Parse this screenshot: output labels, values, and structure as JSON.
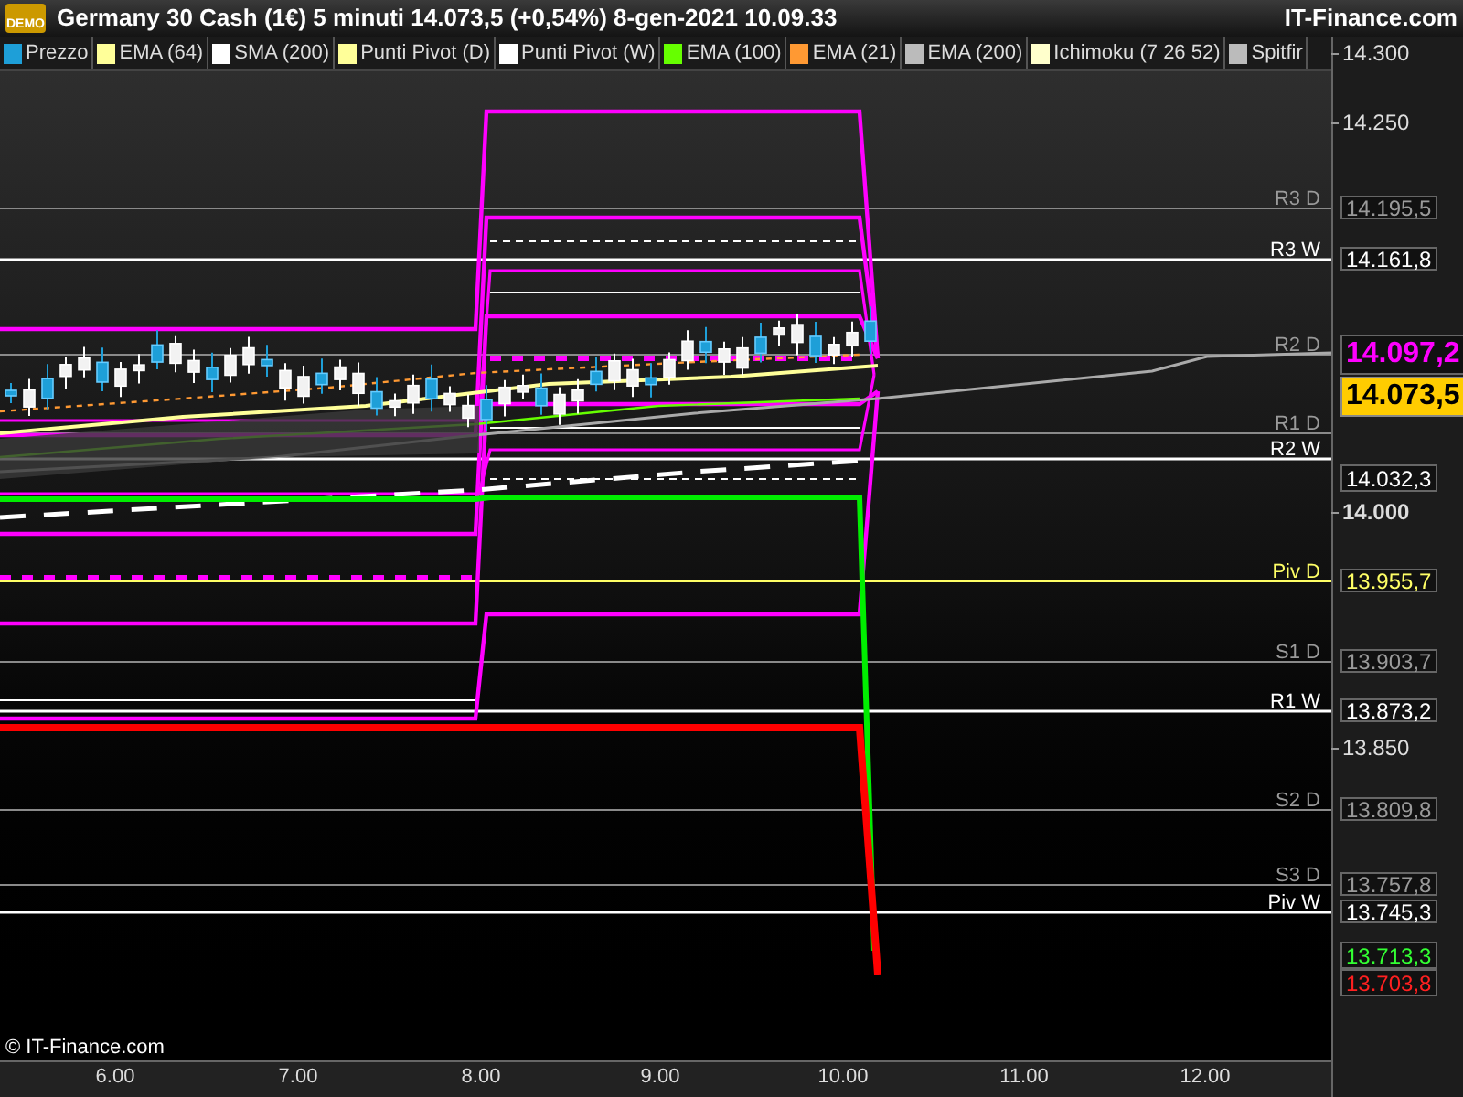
{
  "window": {
    "badge": "DEMO",
    "title": "Germany 30 Cash (1€) 5 minuti 14.073,5 (+0,54%) 8-gen-2021 10.09.33",
    "brand": "IT-Finance.com"
  },
  "legend": [
    {
      "label": "Prezzo",
      "color": "#1e9fd8"
    },
    {
      "label": "EMA (64)",
      "color": "#ffff99"
    },
    {
      "label": "SMA (200)",
      "color": "#ffffff"
    },
    {
      "label": "Punti Pivot (D)",
      "color": "#ffff99"
    },
    {
      "label": "Punti Pivot (W)",
      "color": "#ffffff"
    },
    {
      "label": "EMA (100)",
      "color": "#66ff00"
    },
    {
      "label": "EMA (21)",
      "color": "#ff9933"
    },
    {
      "label": "EMA (200)",
      "color": "#bbbbbb"
    },
    {
      "label": "Ichimoku (7 26 52)",
      "color": "#ffffcc"
    },
    {
      "label": "Spitfir",
      "color": "#bbbbbb"
    }
  ],
  "y_axis": {
    "ticks": [
      {
        "label": "14.300",
        "bold": false
      },
      {
        "label": "14.250",
        "bold": false
      },
      {
        "label": "14.000",
        "bold": true
      },
      {
        "label": "13.850",
        "bold": false
      }
    ]
  },
  "levels": [
    {
      "label": "R3 D",
      "value": "14.195,5",
      "kind": "daily"
    },
    {
      "label": "R3 W",
      "value": "14.161,8",
      "kind": "weekly"
    },
    {
      "label": "R2 D",
      "kind": "daily"
    },
    {
      "label": "R1 D",
      "kind": "daily"
    },
    {
      "label": "R2 W",
      "kind": "weekly"
    },
    {
      "label": "Piv D",
      "value": "13.955,7",
      "kind": "pivot"
    },
    {
      "label": "S1 D",
      "value": "13.903,7",
      "kind": "daily"
    },
    {
      "label": "R1 W",
      "value": "13.873,2",
      "kind": "weekly"
    },
    {
      "label": "S2 D",
      "value": "13.809,8",
      "kind": "daily"
    },
    {
      "label": "S3 D",
      "value": "13.757,8",
      "kind": "daily"
    },
    {
      "label": "Piv W",
      "value": "13.745,3",
      "kind": "weekly"
    }
  ],
  "price_tags": [
    {
      "value": "14.097,2",
      "kind": "large",
      "color": "#ff00ff"
    },
    {
      "value": "14.073,5",
      "kind": "highlight",
      "color": "#ffcc00"
    },
    {
      "value": "14.032,3",
      "kind": "small",
      "color": "#ffffff"
    },
    {
      "value": "13.713,3",
      "kind": "small",
      "color": "#33ff33"
    },
    {
      "value": "13.703,8",
      "kind": "small",
      "color": "#ff2020"
    }
  ],
  "copyright": "© IT-Finance.com",
  "x_axis": {
    "ticks": [
      "6.00",
      "7.00",
      "8.00",
      "9.00",
      "10.00",
      "11.00",
      "12.00"
    ]
  }
}
